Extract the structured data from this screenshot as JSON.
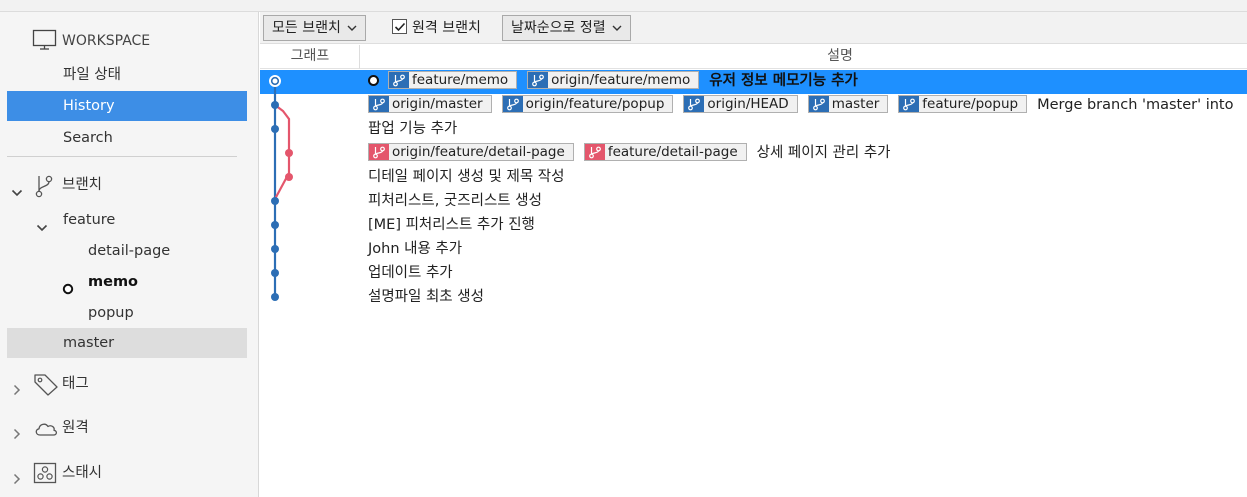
{
  "colors": {
    "accent": "#3d8ee6",
    "selected_row": "#1e90ff",
    "branch_blue": "#2c6eb5",
    "branch_red": "#e4566c"
  },
  "sidebar": {
    "workspace_label": "WORKSPACE",
    "workspace_icon": "monitor-icon",
    "workspace_items": [
      {
        "label": "파일 상태"
      },
      {
        "label": "History"
      },
      {
        "label": "Search"
      }
    ],
    "branches": {
      "label": "브랜치",
      "icon": "branch-icon",
      "folder": "feature",
      "children": [
        {
          "label": "detail-page"
        },
        {
          "label": "memo",
          "current": true
        },
        {
          "label": "popup"
        }
      ],
      "master": "master"
    },
    "tags": {
      "label": "태그",
      "icon": "tag-icon"
    },
    "remotes": {
      "label": "원격",
      "icon": "cloud-icon"
    },
    "stashes": {
      "label": "스태시",
      "icon": "stash-icon"
    }
  },
  "toolbar": {
    "branch_filter": "모든 브랜치",
    "remote_branches_label": "원격 브랜치",
    "remote_branches_checked": true,
    "sort_order": "날짜순으로 정렬"
  },
  "columns": {
    "graph": "그래프",
    "description": "설명"
  },
  "commits": [
    {
      "message": "유저 정보 메모기능 추가",
      "head": true,
      "refs": [
        {
          "name": "feature/memo",
          "color": "blue"
        },
        {
          "name": "origin/feature/memo",
          "color": "blue"
        }
      ]
    },
    {
      "message": "Merge branch 'master' into",
      "refs": [
        {
          "name": "origin/master",
          "color": "blue"
        },
        {
          "name": "origin/feature/popup",
          "color": "blue"
        },
        {
          "name": "origin/HEAD",
          "color": "blue"
        },
        {
          "name": "master",
          "color": "blue"
        },
        {
          "name": "feature/popup",
          "color": "blue"
        }
      ]
    },
    {
      "message": "팝업 기능 추가",
      "refs": []
    },
    {
      "message": "상세 페이지 관리 추가",
      "refs": [
        {
          "name": "origin/feature/detail-page",
          "color": "red"
        },
        {
          "name": "feature/detail-page",
          "color": "red"
        }
      ]
    },
    {
      "message": "디테일 페이지 생성 및 제목 작성",
      "refs": []
    },
    {
      "message": "피처리스트, 굿즈리스트 생성",
      "refs": []
    },
    {
      "message": "[ME] 피처리스트 추가 진행",
      "refs": []
    },
    {
      "message": "John 내용 추가",
      "refs": []
    },
    {
      "message": "업데이트 추가",
      "refs": []
    },
    {
      "message": "설명파일 최초 생성",
      "refs": []
    }
  ]
}
